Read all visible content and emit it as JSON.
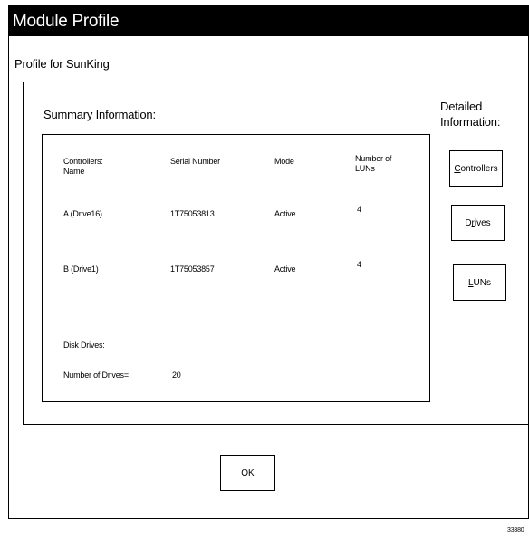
{
  "window": {
    "title": "Module Profile"
  },
  "profile_heading": "Profile for SunKing",
  "summary": {
    "heading": "Summary Information:",
    "columns": {
      "name_line1": "Controllers:",
      "name_line2": "Name",
      "serial": "Serial Number",
      "mode": "Mode",
      "luns_line1": "Number of",
      "luns_line2": "LUNs"
    },
    "rows": [
      {
        "name": "A (Drive16)",
        "serial": "1T75053813",
        "mode": "Active",
        "luns": "4"
      },
      {
        "name": "B (Drive1)",
        "serial": "1T75053857",
        "mode": "Active",
        "luns": "4"
      }
    ],
    "disk_drives_label": "Disk Drives:",
    "number_of_drives_label": "Number of Drives=",
    "number_of_drives_value": "20"
  },
  "detailed": {
    "heading_line1": "Detailed",
    "heading_line2": "Information:",
    "buttons": {
      "controllers": {
        "mnemonic": "C",
        "rest": "ontrollers"
      },
      "drives": {
        "prefix": "D",
        "mnemonic": "r",
        "rest": "ives"
      },
      "luns": {
        "mnemonic": "L",
        "rest": "UNs"
      }
    }
  },
  "ok_label": "OK",
  "figure_number": "33380"
}
